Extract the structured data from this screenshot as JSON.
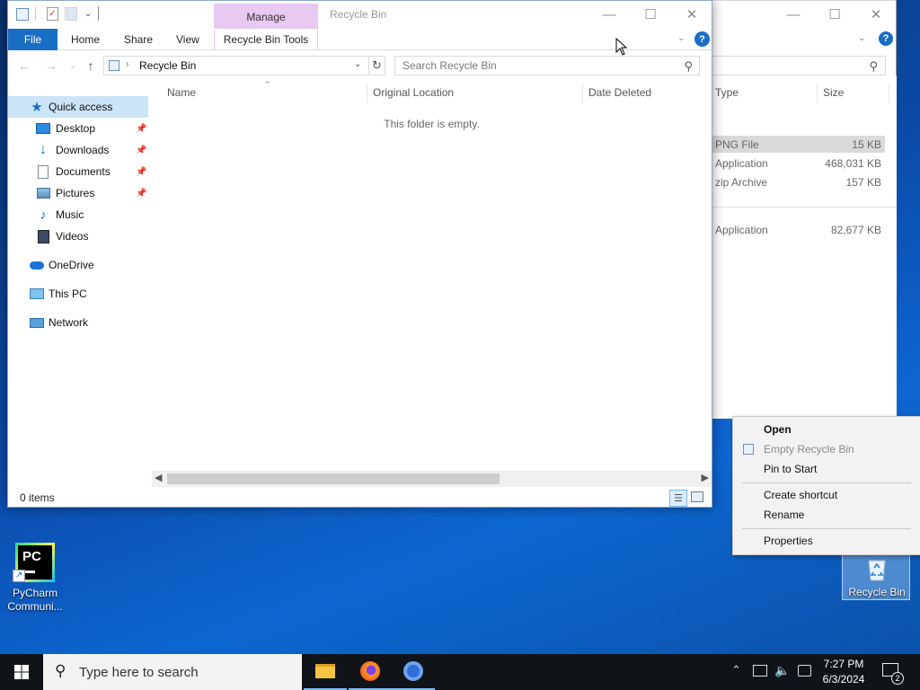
{
  "back_window": {
    "columns": {
      "type": "Type",
      "size": "Size"
    },
    "rows": [
      {
        "type": "PNG File",
        "size": "15 KB"
      },
      {
        "type": "Application",
        "size": "468,031 KB"
      },
      {
        "type": "zip Archive",
        "size": "157 KB"
      },
      {
        "type": "Application",
        "size": "82,677 KB"
      }
    ]
  },
  "front_window": {
    "title": "Recycle Bin",
    "contextual_tab_group": "Manage",
    "ribbon_tabs": {
      "file": "File",
      "home": "Home",
      "share": "Share",
      "view": "View",
      "tools": "Recycle Bin Tools"
    },
    "address": "Recycle Bin",
    "search_placeholder": "Search Recycle Bin",
    "columns": {
      "name": "Name",
      "original_location": "Original Location",
      "date_deleted": "Date Deleted"
    },
    "empty_message": "This folder is empty.",
    "status": "0 items",
    "nav": {
      "quick_access": "Quick access",
      "desktop": "Desktop",
      "downloads": "Downloads",
      "documents": "Documents",
      "pictures": "Pictures",
      "music": "Music",
      "videos": "Videos",
      "onedrive": "OneDrive",
      "this_pc": "This PC",
      "network": "Network"
    }
  },
  "context_menu": {
    "open": "Open",
    "empty": "Empty Recycle Bin",
    "pin": "Pin to Start",
    "shortcut": "Create shortcut",
    "rename": "Rename",
    "properties": "Properties"
  },
  "desktop_icons": {
    "pycharm_badge": "PC",
    "pycharm_label_1": "PyCharm",
    "pycharm_label_2": "Communi...",
    "recycle_label": "Recycle Bin"
  },
  "taskbar": {
    "search_placeholder": "Type here to search",
    "time": "7:27 PM",
    "date": "6/3/2024",
    "notification_count": "2"
  },
  "colors": {
    "accent": "#1a6dc4",
    "manage_tab": "#e8c9f2",
    "taskbar": "#101418",
    "selection": "#cce4f7"
  }
}
